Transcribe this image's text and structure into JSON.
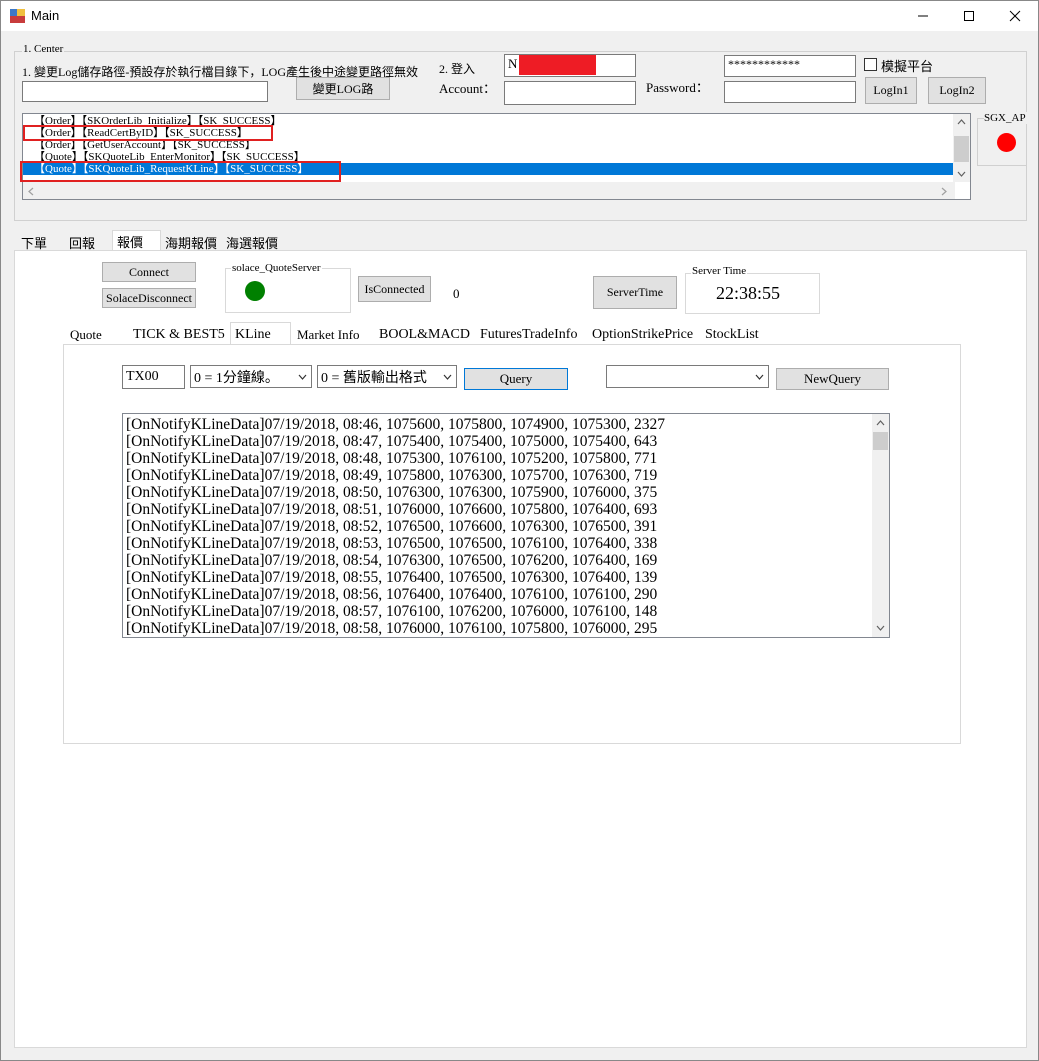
{
  "window": {
    "title": "Main",
    "minimize": "—",
    "maximize": "☐",
    "close": "✕"
  },
  "center": {
    "group_label": "1. Center",
    "log_path_label": "1. 變更Log儲存路徑-預設存於執行檔目錄下，LOG產生後中途變更路徑無效",
    "log_path_value": "",
    "change_log_button": "變更LOG路",
    "login_label": "2. 登入",
    "account_label": "Account：",
    "account_value_1": "N",
    "account_value_2": "",
    "password_label": "Password：",
    "password_value_1": "************",
    "password_value_2": "",
    "simulate_label": "模擬平台",
    "login1_button": "LogIn1",
    "login2_button": "LogIn2",
    "sgx_label": "SGX_AP",
    "sgx_status_color": "#ff0000"
  },
  "log_list": [
    "【Order】【SKOrderLib_Initialize】【SK_SUCCESS】",
    "【Order】【ReadCertByID】【SK_SUCCESS】",
    "【Order】【GetUserAccount】【SK_SUCCESS】",
    "【Quote】【SKQuoteLib_EnterMonitor】【SK_SUCCESS】",
    "【Quote】【SKQuoteLib_RequestKLine】【SK_SUCCESS】"
  ],
  "main_tabs": [
    "下單",
    "回報",
    "報價",
    "海期報價",
    "海選報價"
  ],
  "quote_panel": {
    "connect_button": "Connect",
    "solace_disconnect_button": "SolaceDisconnect",
    "solace_group_label": "solace_QuoteServer",
    "solace_status_color": "#008000",
    "is_connected_button": "IsConnected",
    "is_connected_value": "0",
    "server_time_button": "ServerTime",
    "server_time_group_label": "Server Time",
    "server_time_value": "22:38:55"
  },
  "sub_tabs": [
    "Quote",
    "TICK & BEST5",
    "KLine",
    "Market Info",
    "BOOL&MACD",
    "FuturesTradeInfo",
    "OptionStrikePrice",
    "StockList"
  ],
  "kline": {
    "symbol_value": "TX00",
    "type_select": "0 = 1分鐘線。",
    "format_select": "0 = 舊版輸出格式",
    "query_button": "Query",
    "new_query_select": "",
    "new_query_button": "NewQuery",
    "lines": [
      "[OnNotifyKLineData]07/19/2018, 08:46, 1075600, 1075800, 1074900, 1075300, 2327",
      "[OnNotifyKLineData]07/19/2018, 08:47, 1075400, 1075400, 1075000, 1075400, 643",
      "[OnNotifyKLineData]07/19/2018, 08:48, 1075300, 1076100, 1075200, 1075800, 771",
      "[OnNotifyKLineData]07/19/2018, 08:49, 1075800, 1076300, 1075700, 1076300, 719",
      "[OnNotifyKLineData]07/19/2018, 08:50, 1076300, 1076300, 1075900, 1076000, 375",
      "[OnNotifyKLineData]07/19/2018, 08:51, 1076000, 1076600, 1075800, 1076400, 693",
      "[OnNotifyKLineData]07/19/2018, 08:52, 1076500, 1076600, 1076300, 1076500, 391",
      "[OnNotifyKLineData]07/19/2018, 08:53, 1076500, 1076500, 1076100, 1076400, 338",
      "[OnNotifyKLineData]07/19/2018, 08:54, 1076300, 1076500, 1076200, 1076400, 169",
      "[OnNotifyKLineData]07/19/2018, 08:55, 1076400, 1076500, 1076300, 1076400, 139",
      "[OnNotifyKLineData]07/19/2018, 08:56, 1076400, 1076400, 1076100, 1076100, 290",
      "[OnNotifyKLineData]07/19/2018, 08:57, 1076100, 1076200, 1076000, 1076100, 148",
      "[OnNotifyKLineData]07/19/2018, 08:58, 1076000, 1076100, 1075800, 1076000, 295"
    ]
  }
}
